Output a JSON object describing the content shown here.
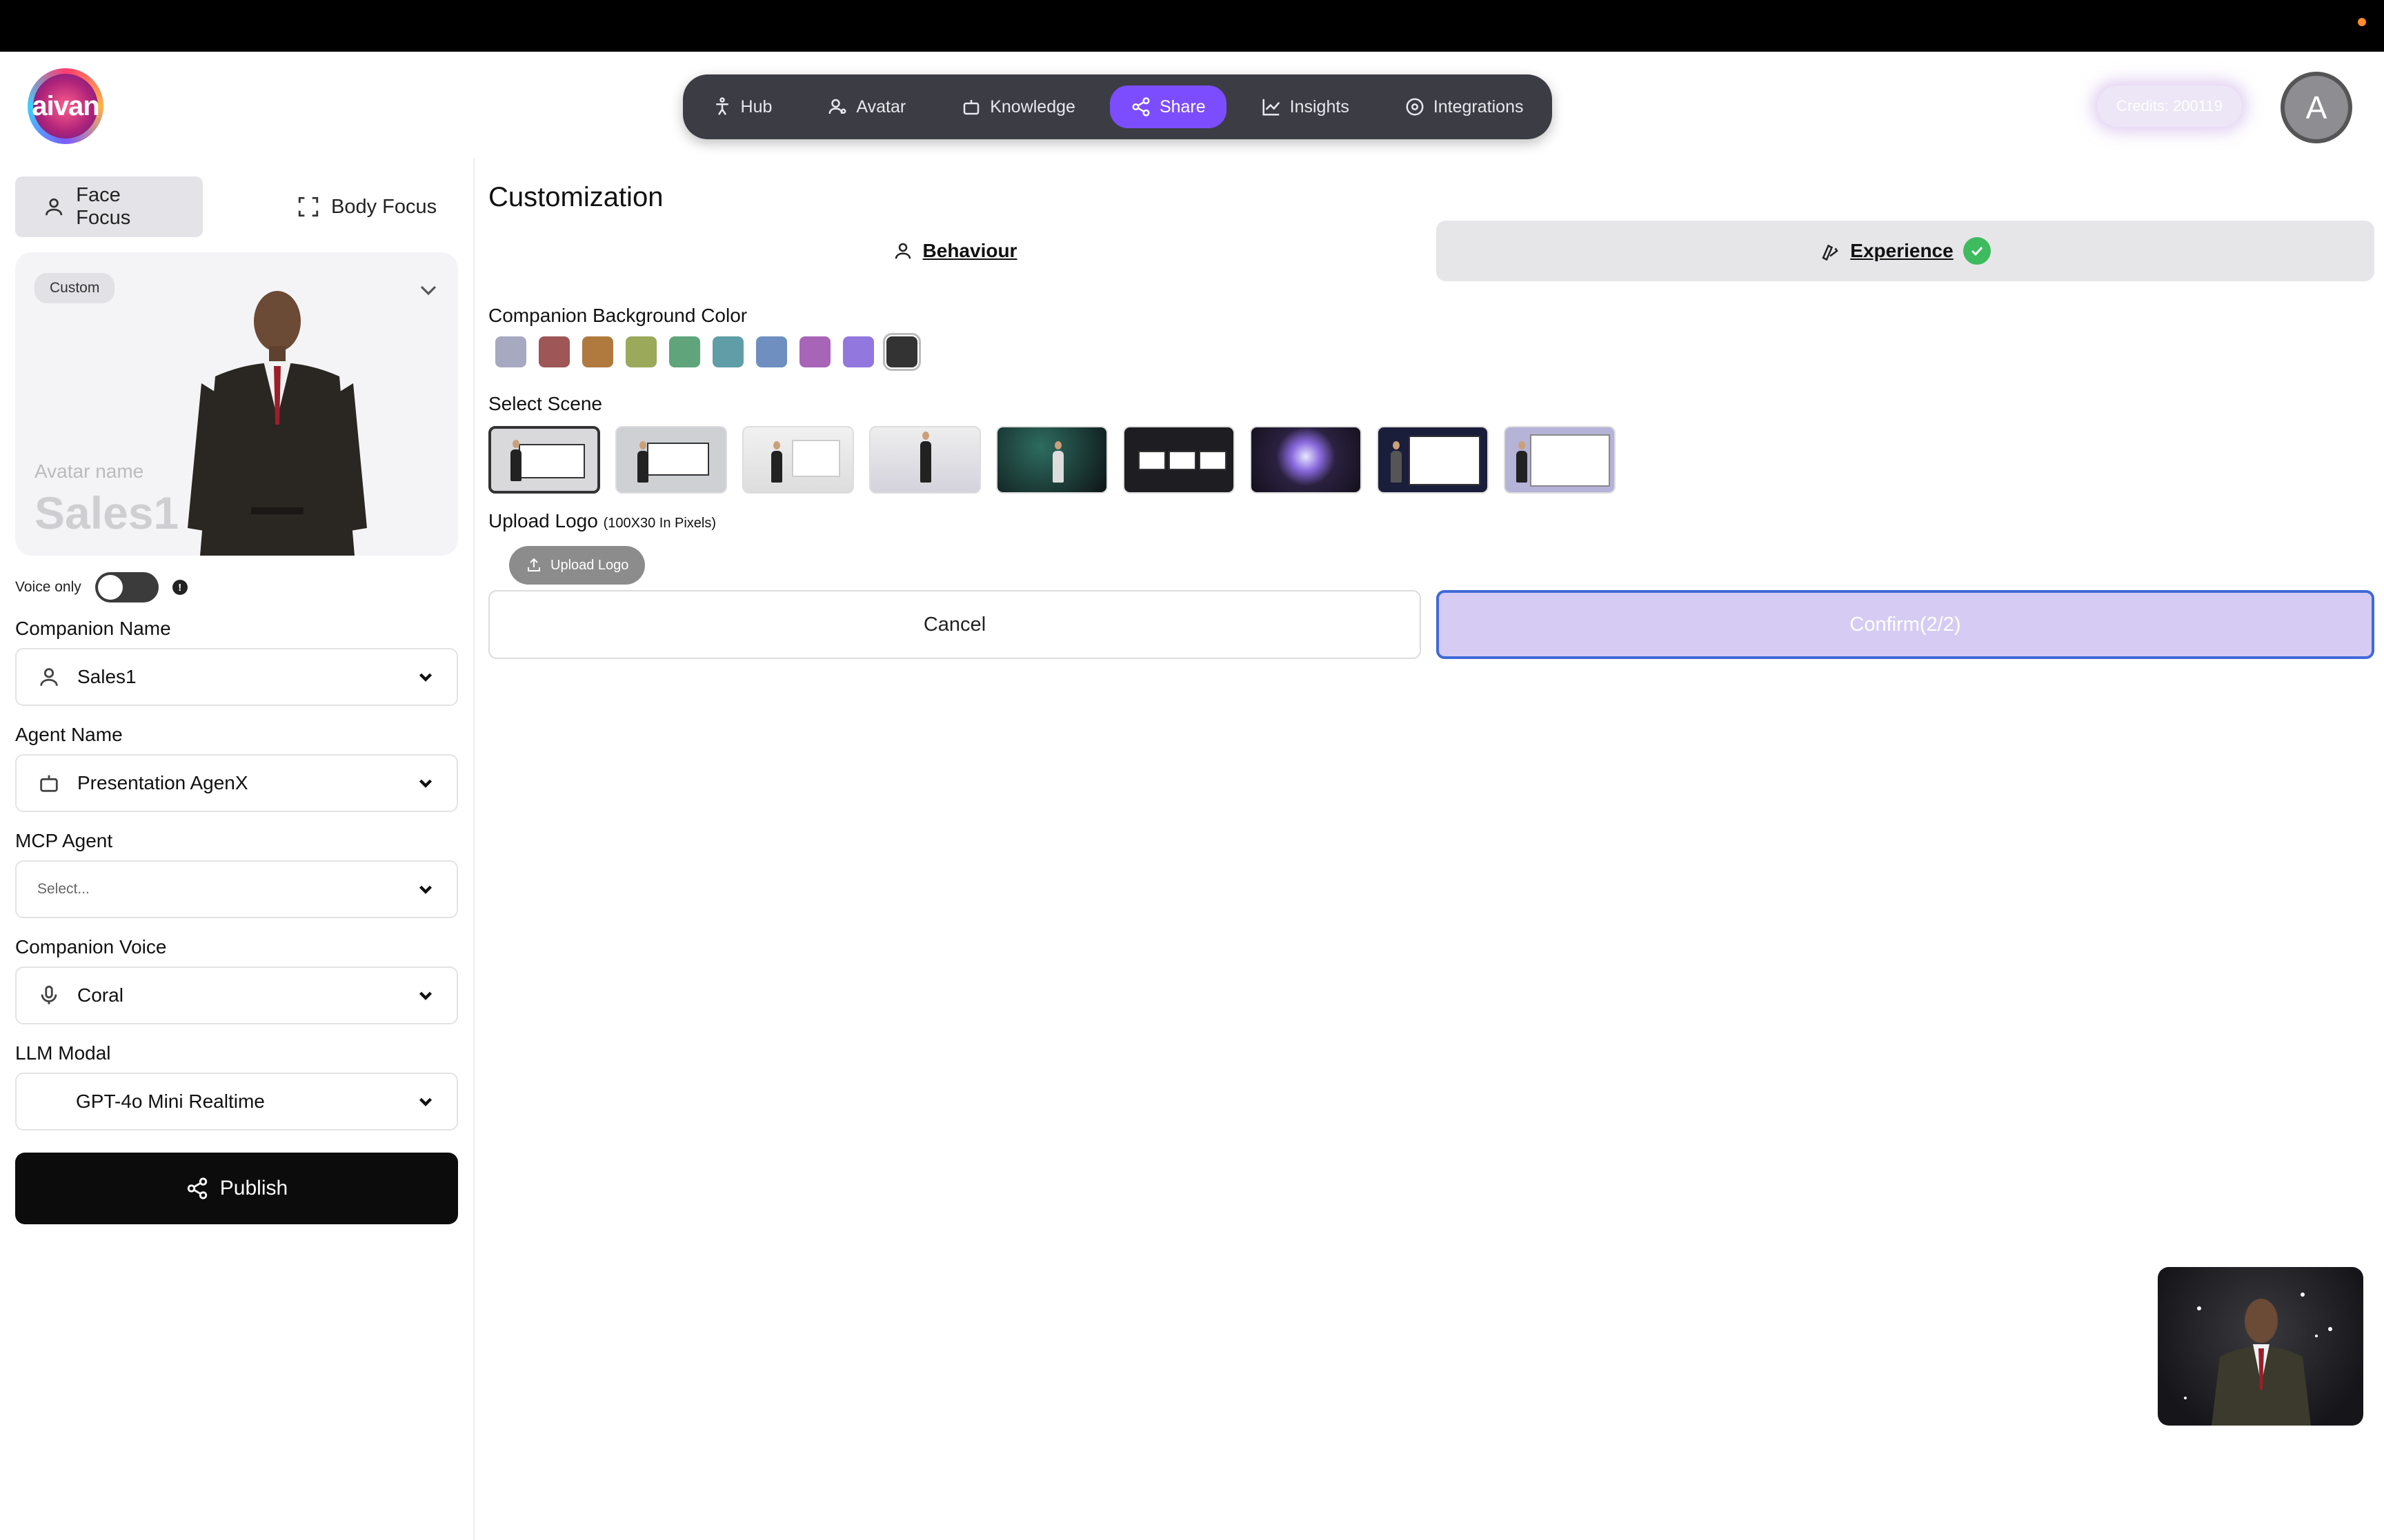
{
  "logo": {
    "text": "aivan"
  },
  "nav": {
    "items": [
      {
        "label": "Hub",
        "icon": "person-icon"
      },
      {
        "label": "Avatar",
        "icon": "avatar-icon"
      },
      {
        "label": "Knowledge",
        "icon": "robot-icon"
      },
      {
        "label": "Share",
        "icon": "share-icon",
        "active": true
      },
      {
        "label": "Insights",
        "icon": "chart-icon"
      },
      {
        "label": "Integrations",
        "icon": "integrations-icon"
      }
    ]
  },
  "header": {
    "credits": "Credits: 200119",
    "user_initial": "A"
  },
  "left": {
    "face_focus": "Face Focus",
    "body_focus": "Body Focus",
    "card": {
      "badge": "Custom",
      "name_label": "Avatar name",
      "name": "Sales1"
    },
    "voice_only_label": "Voice only",
    "voice_only_on": false,
    "info_glyph": "!",
    "companion_name": {
      "label": "Companion Name",
      "value": "Sales1"
    },
    "agent_name": {
      "label": "Agent Name",
      "value": "Presentation AgenX"
    },
    "mcp_agent": {
      "label": "MCP Agent",
      "placeholder": "Select..."
    },
    "companion_voice": {
      "label": "Companion Voice",
      "value": "Coral"
    },
    "llm_modal": {
      "label": "LLM Modal",
      "value": "GPT-4o Mini Realtime"
    },
    "publish": "Publish"
  },
  "main": {
    "title": "Customization",
    "tabs": {
      "behaviour": "Behaviour",
      "experience": "Experience"
    },
    "bg_color_label": "Companion Background Color",
    "colors": [
      "#a7a9c0",
      "#9e5656",
      "#b07a3e",
      "#9aa95a",
      "#5fa47a",
      "#5f9ea6",
      "#6f8fc0",
      "#a865b8",
      "#9277df",
      "#333333"
    ],
    "selected_color": "#333333",
    "scene_label": "Select Scene",
    "scenes": [
      "scene-1",
      "scene-2",
      "scene-3",
      "scene-4",
      "scene-5",
      "scene-6",
      "scene-7",
      "scene-8",
      "scene-9"
    ],
    "selected_scene": "scene-1",
    "upload_title": "Upload Logo",
    "upload_hint": "(100X30 In Pixels)",
    "upload_button": "Upload Logo",
    "cancel": "Cancel",
    "confirm": "Confirm(2/2)"
  }
}
